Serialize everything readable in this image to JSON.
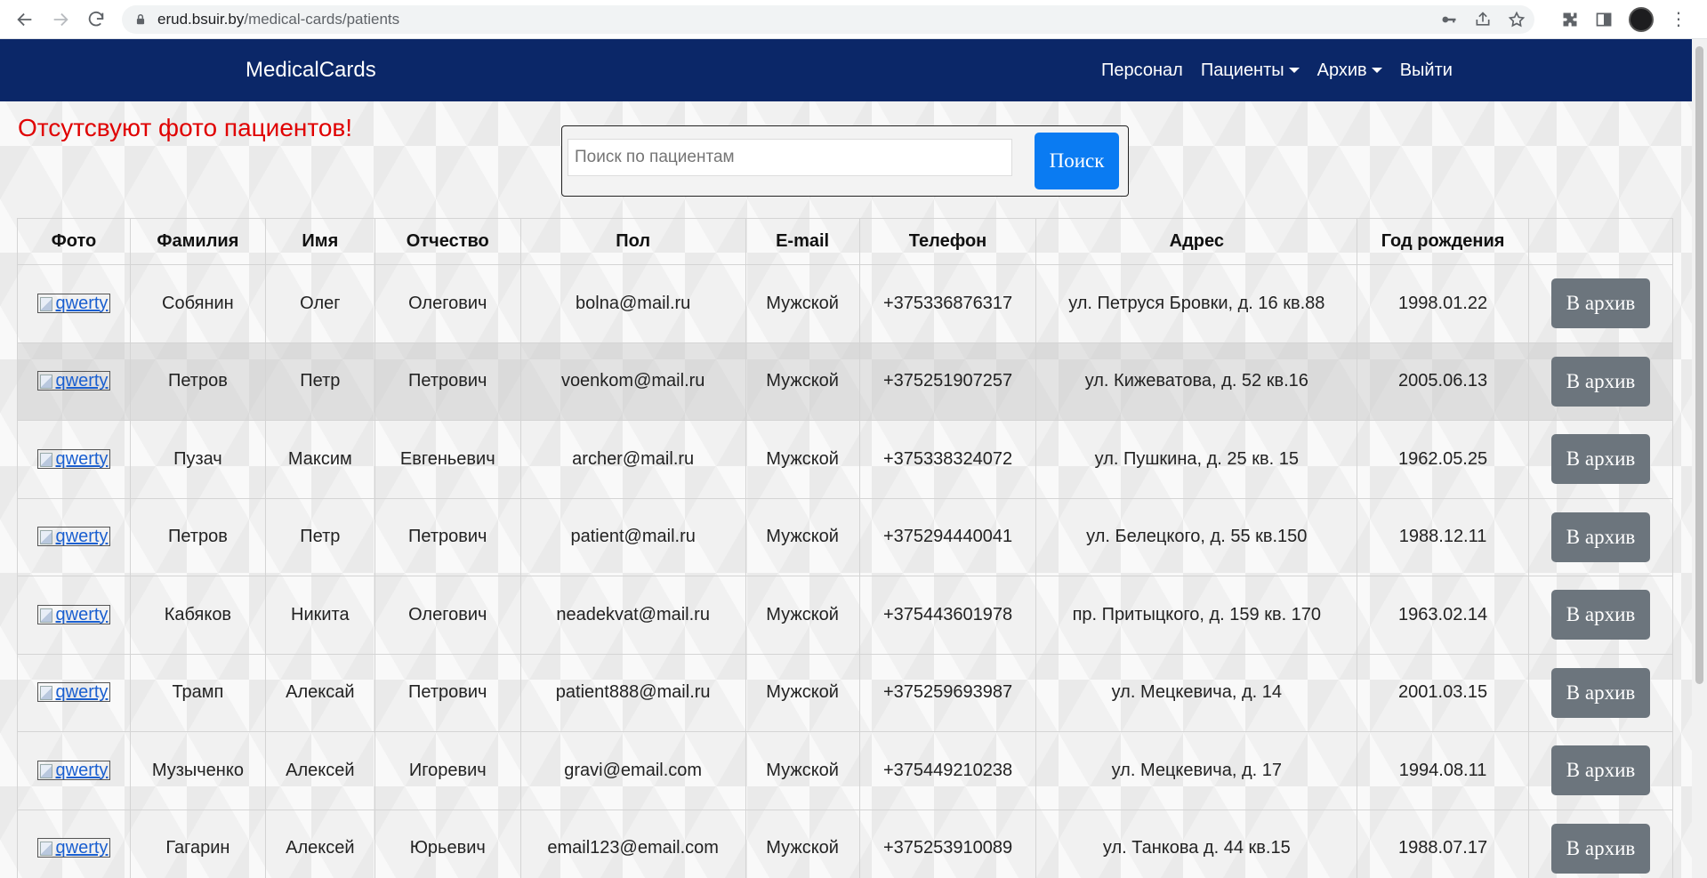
{
  "browser": {
    "url_host": "erud.bsuir.by",
    "url_path": "/medical-cards/patients"
  },
  "navbar": {
    "brand": "MedicalCards",
    "links": [
      {
        "label": "Персонал"
      },
      {
        "label": "Пациенты"
      },
      {
        "label": "Архив"
      },
      {
        "label": "Выйти"
      }
    ]
  },
  "warning": "Отсутсвуют фото пациентов!",
  "search": {
    "placeholder": "Поиск по пациентам",
    "button": "Поиск"
  },
  "table": {
    "headers": [
      "Фото",
      "Фамилия",
      "Имя",
      "Отчество",
      "Пол",
      "E-mail",
      "Телефон",
      "Адрес",
      "Год рождения",
      ""
    ],
    "photo_alt": "qwerty",
    "archive_label": "В архив",
    "rows": [
      [
        "Собянин",
        "Олег",
        "Олегович",
        "bolna@mail.ru",
        "Мужской",
        "+375336876317",
        "ул. Петруся Бровки, д. 16 кв.88",
        "1998.01.22"
      ],
      [
        "Петров",
        "Петр",
        "Петрович",
        "voenkom@mail.ru",
        "Мужской",
        "+375251907257",
        "ул. Кижеватова, д. 52 кв.16",
        "2005.06.13"
      ],
      [
        "Пузач",
        "Максим",
        "Евгеньевич",
        "archer@mail.ru",
        "Мужской",
        "+375338324072",
        "ул. Пушкина, д. 25 кв. 15",
        "1962.05.25"
      ],
      [
        "Петров",
        "Петр",
        "Петрович",
        "patient@mail.ru",
        "Мужской",
        "+375294440041",
        "ул. Белецкого, д. 55 кв.150",
        "1988.12.11"
      ],
      [
        "Кабяков",
        "Никита",
        "Олегович",
        "neadekvat@mail.ru",
        "Мужской",
        "+375443601978",
        "пр. Притыцкого, д. 159 кв. 170",
        "1963.02.14"
      ],
      [
        "Трамп",
        "Алексай",
        "Петрович",
        "patient888@mail.ru",
        "Мужской",
        "+375259693987",
        "ул. Мецкевича, д. 14",
        "2001.03.15"
      ],
      [
        "Музыченко",
        "Алексей",
        "Игоревич",
        "gravi@email.com",
        "Мужской",
        "+375449210238",
        "ул. Мецкевича, д. 17",
        "1994.08.11"
      ],
      [
        "Гагарин",
        "Алексей",
        "Юрьевич",
        "email123@email.com",
        "Мужской",
        "+375253910089",
        "ул. Танкова д. 44 кв.15",
        "1988.07.17"
      ]
    ]
  }
}
